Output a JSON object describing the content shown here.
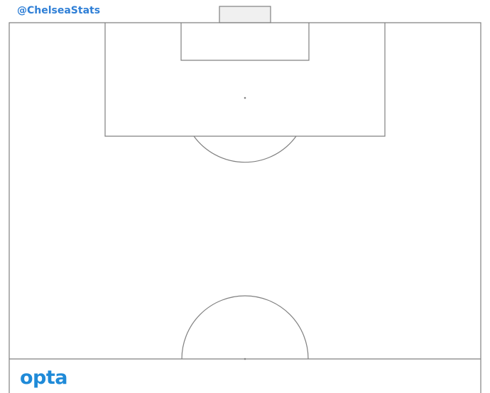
{
  "header": {
    "handle": "@ChelseaStats"
  },
  "footer": {
    "logo_text": "opta"
  },
  "colors": {
    "handle": "#2f7fd6",
    "logo": "#1f8ad8",
    "pitch_lines": "#808080",
    "goal_fill": "#f0f0f0"
  }
}
